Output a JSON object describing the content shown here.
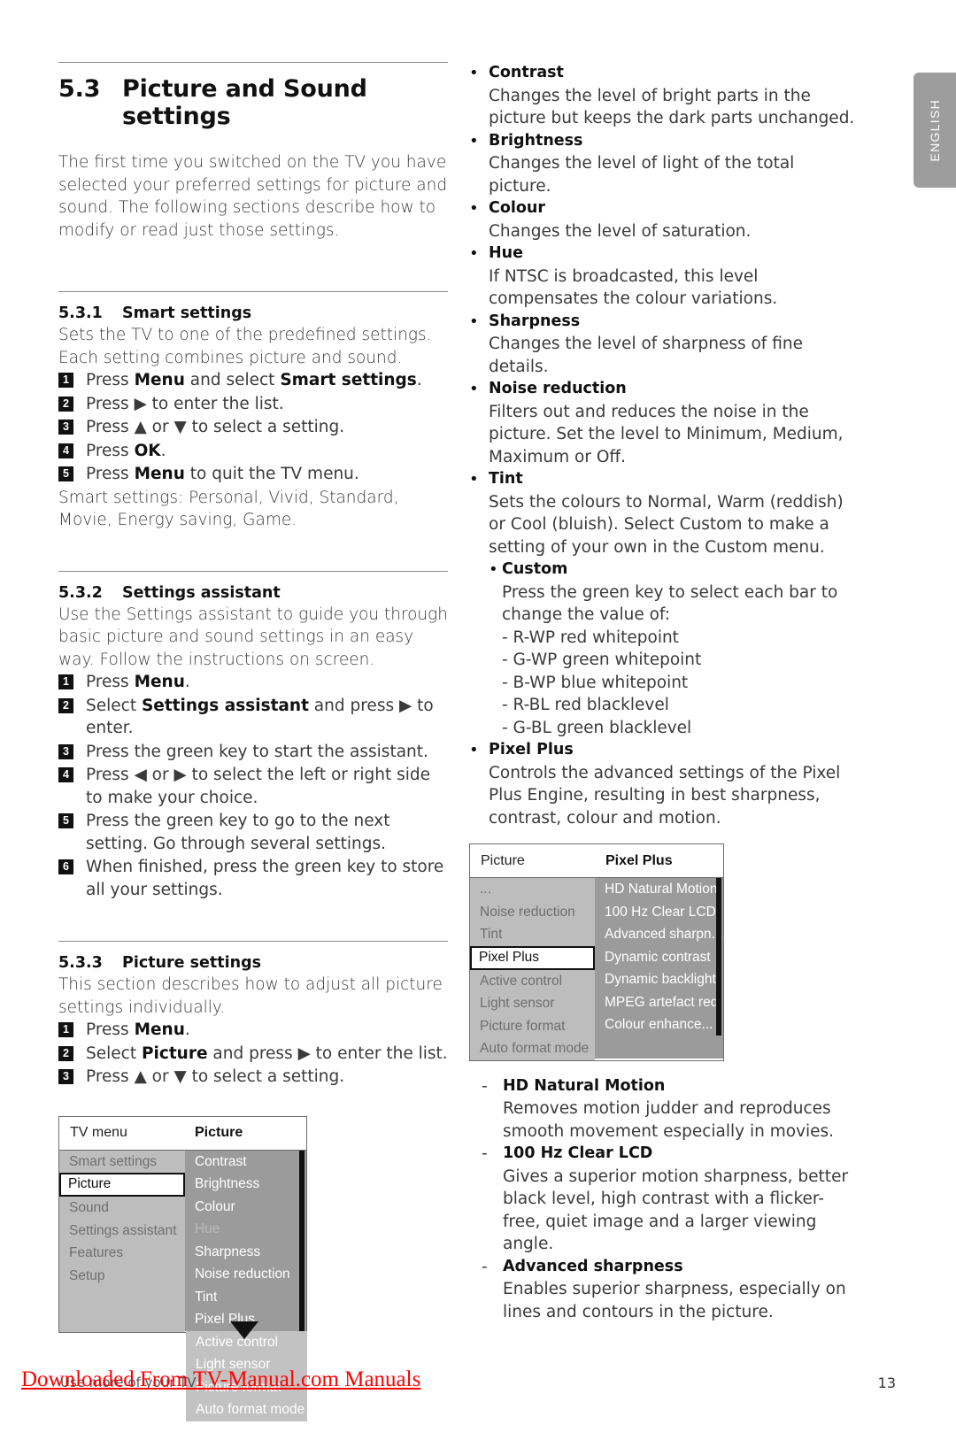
{
  "language_tab": {
    "label": "ENGLISH"
  },
  "section": {
    "number": "5.3",
    "title": "Picture and Sound settings",
    "intro": "The first time you switched on the TV you have selected your preferred settings for picture and sound. The following sections describe how to modify or read just those settings."
  },
  "smart_settings": {
    "number": "5.3.1",
    "title": "Smart settings",
    "intro": "Sets the TV to one of the predefined settings. Each setting combines picture and sound.",
    "steps": [
      {
        "n": "1",
        "pre": "Press ",
        "bold1": "Menu",
        "mid": " and select ",
        "bold2": "Smart settings",
        "post": "."
      },
      {
        "n": "2",
        "text": "Press ▶  to enter the list."
      },
      {
        "n": "3",
        "text": "Press ▲  or ▼  to select a setting."
      },
      {
        "n": "4",
        "pre": "Press ",
        "bold1": "OK",
        "post": "."
      },
      {
        "n": "5",
        "pre": "Press ",
        "bold1": "Menu",
        "post": " to quit the TV menu."
      }
    ],
    "outro": "Smart settings: Personal, Vivid, Standard, Movie, Energy saving, Game."
  },
  "settings_assistant": {
    "number": "5.3.2",
    "title": "Settings assistant",
    "intro": "Use the Settings assistant to guide you through basic picture and sound settings in an easy way. Follow the instructions on screen.",
    "steps": [
      {
        "n": "1",
        "pre": "Press ",
        "bold1": "Menu",
        "post": "."
      },
      {
        "n": "2",
        "pre": "Select ",
        "bold1": "Settings assistant",
        "post": " and press ▶  to enter."
      },
      {
        "n": "3",
        "text": "Press the green key to start the assistant."
      },
      {
        "n": "4",
        "text": "Press ◀  or ▶  to select the left or right side to make your choice."
      },
      {
        "n": "5",
        "text": "Press the green key to go to the next setting. Go through several settings."
      },
      {
        "n": "6",
        "text": "When finished, press the green key to store all your settings."
      }
    ]
  },
  "picture_settings": {
    "number": "5.3.3",
    "title": "Picture settings",
    "intro": "This section describes how to adjust all picture settings individually.",
    "steps": [
      {
        "n": "1",
        "pre": "Press ",
        "bold1": "Menu",
        "post": "."
      },
      {
        "n": "2",
        "pre": "Select ",
        "bold1": "Picture",
        "post": " and press ▶  to enter the list."
      },
      {
        "n": "3",
        "text": "Press ▲  or ▼  to select a setting."
      }
    ]
  },
  "tv_menu_figure": {
    "title_left": "TV menu",
    "title_right": "Picture",
    "left_items": [
      {
        "label": "Smart settings",
        "selected": false
      },
      {
        "label": "Picture",
        "selected": true
      },
      {
        "label": "Sound",
        "selected": false
      },
      {
        "label": "Settings assistant",
        "selected": false
      },
      {
        "label": "Features",
        "selected": false
      },
      {
        "label": "Setup",
        "selected": false
      },
      {
        "label": "",
        "selected": false
      },
      {
        "label": "",
        "selected": false
      }
    ],
    "right_items": [
      {
        "label": "Contrast",
        "dim": false
      },
      {
        "label": "Brightness",
        "dim": false
      },
      {
        "label": "Colour",
        "dim": false
      },
      {
        "label": "Hue",
        "dim": true
      },
      {
        "label": "Sharpness",
        "dim": false
      },
      {
        "label": "Noise reduction",
        "dim": false
      },
      {
        "label": "Tint",
        "dim": false
      },
      {
        "label": "Pixel Plus",
        "dim": false
      }
    ],
    "overflow_items": [
      "Active control",
      "Light sensor",
      "Picture format",
      "Auto format mode"
    ]
  },
  "picture_options": [
    {
      "title": "Contrast",
      "body": "Changes the level of bright parts in the picture but keeps the dark parts unchanged."
    },
    {
      "title": "Brightness",
      "body": "Changes the level of light of the total picture."
    },
    {
      "title": "Colour",
      "body": "Changes the level of saturation."
    },
    {
      "title": "Hue",
      "body": "If NTSC is broadcasted, this level compensates the colour variations."
    },
    {
      "title": "Sharpness",
      "body": "Changes the level of sharpness of fine details."
    },
    {
      "title": "Noise reduction",
      "body": "Filters out and reduces the noise in the picture. Set the level to Minimum, Medium, Maximum or Off."
    },
    {
      "title": "Tint",
      "body": "Sets the colours to Normal, Warm (reddish) or Cool (bluish). Select Custom to make a setting of your own in the Custom menu."
    }
  ],
  "custom_sub": {
    "title": "Custom",
    "body": "Press the green key to select each bar to change the value of:",
    "values": [
      "- R-WP red whitepoint",
      "- G-WP green whitepoint",
      "- B-WP blue whitepoint",
      "- R-BL red blacklevel",
      "- G-BL green blacklevel"
    ]
  },
  "pixel_plus": {
    "title": "Pixel Plus",
    "body": "Controls the advanced settings of the Pixel Plus Engine, resulting in best sharpness, contrast, colour and motion."
  },
  "pixel_plus_figure": {
    "title_left": "Picture",
    "title_right": "Pixel Plus",
    "left_items": [
      {
        "label": "...",
        "selected": false
      },
      {
        "label": "Noise reduction",
        "selected": false
      },
      {
        "label": "Tint",
        "selected": false
      },
      {
        "label": "Pixel Plus",
        "selected": true
      },
      {
        "label": "Active control",
        "selected": false
      },
      {
        "label": "Light sensor",
        "selected": false
      },
      {
        "label": "Picture format",
        "selected": false
      },
      {
        "label": "Auto format mode",
        "selected": false
      }
    ],
    "right_items": [
      "HD Natural Motion",
      "100 Hz Clear LCD",
      "Advanced sharpn...",
      "Dynamic contrast",
      "Dynamic backlight",
      "MPEG artefact red...",
      "Colour enhance...",
      ""
    ]
  },
  "pixel_plus_details": [
    {
      "title": "HD Natural Motion",
      "body": "Removes motion judder and reproduces smooth movement especially in movies."
    },
    {
      "title": "100 Hz Clear LCD",
      "body": "Gives a superior motion sharpness, better black level, high contrast with a flicker-free, quiet image and a larger viewing angle."
    },
    {
      "title": "Advanced sharpness",
      "body": "Enables superior sharpness, especially on lines and contours in the picture."
    }
  ],
  "footer": {
    "running_head": "Use more of your TV",
    "watermark": "Downloaded From TV-Manual.com Manuals",
    "page_number": "13"
  }
}
